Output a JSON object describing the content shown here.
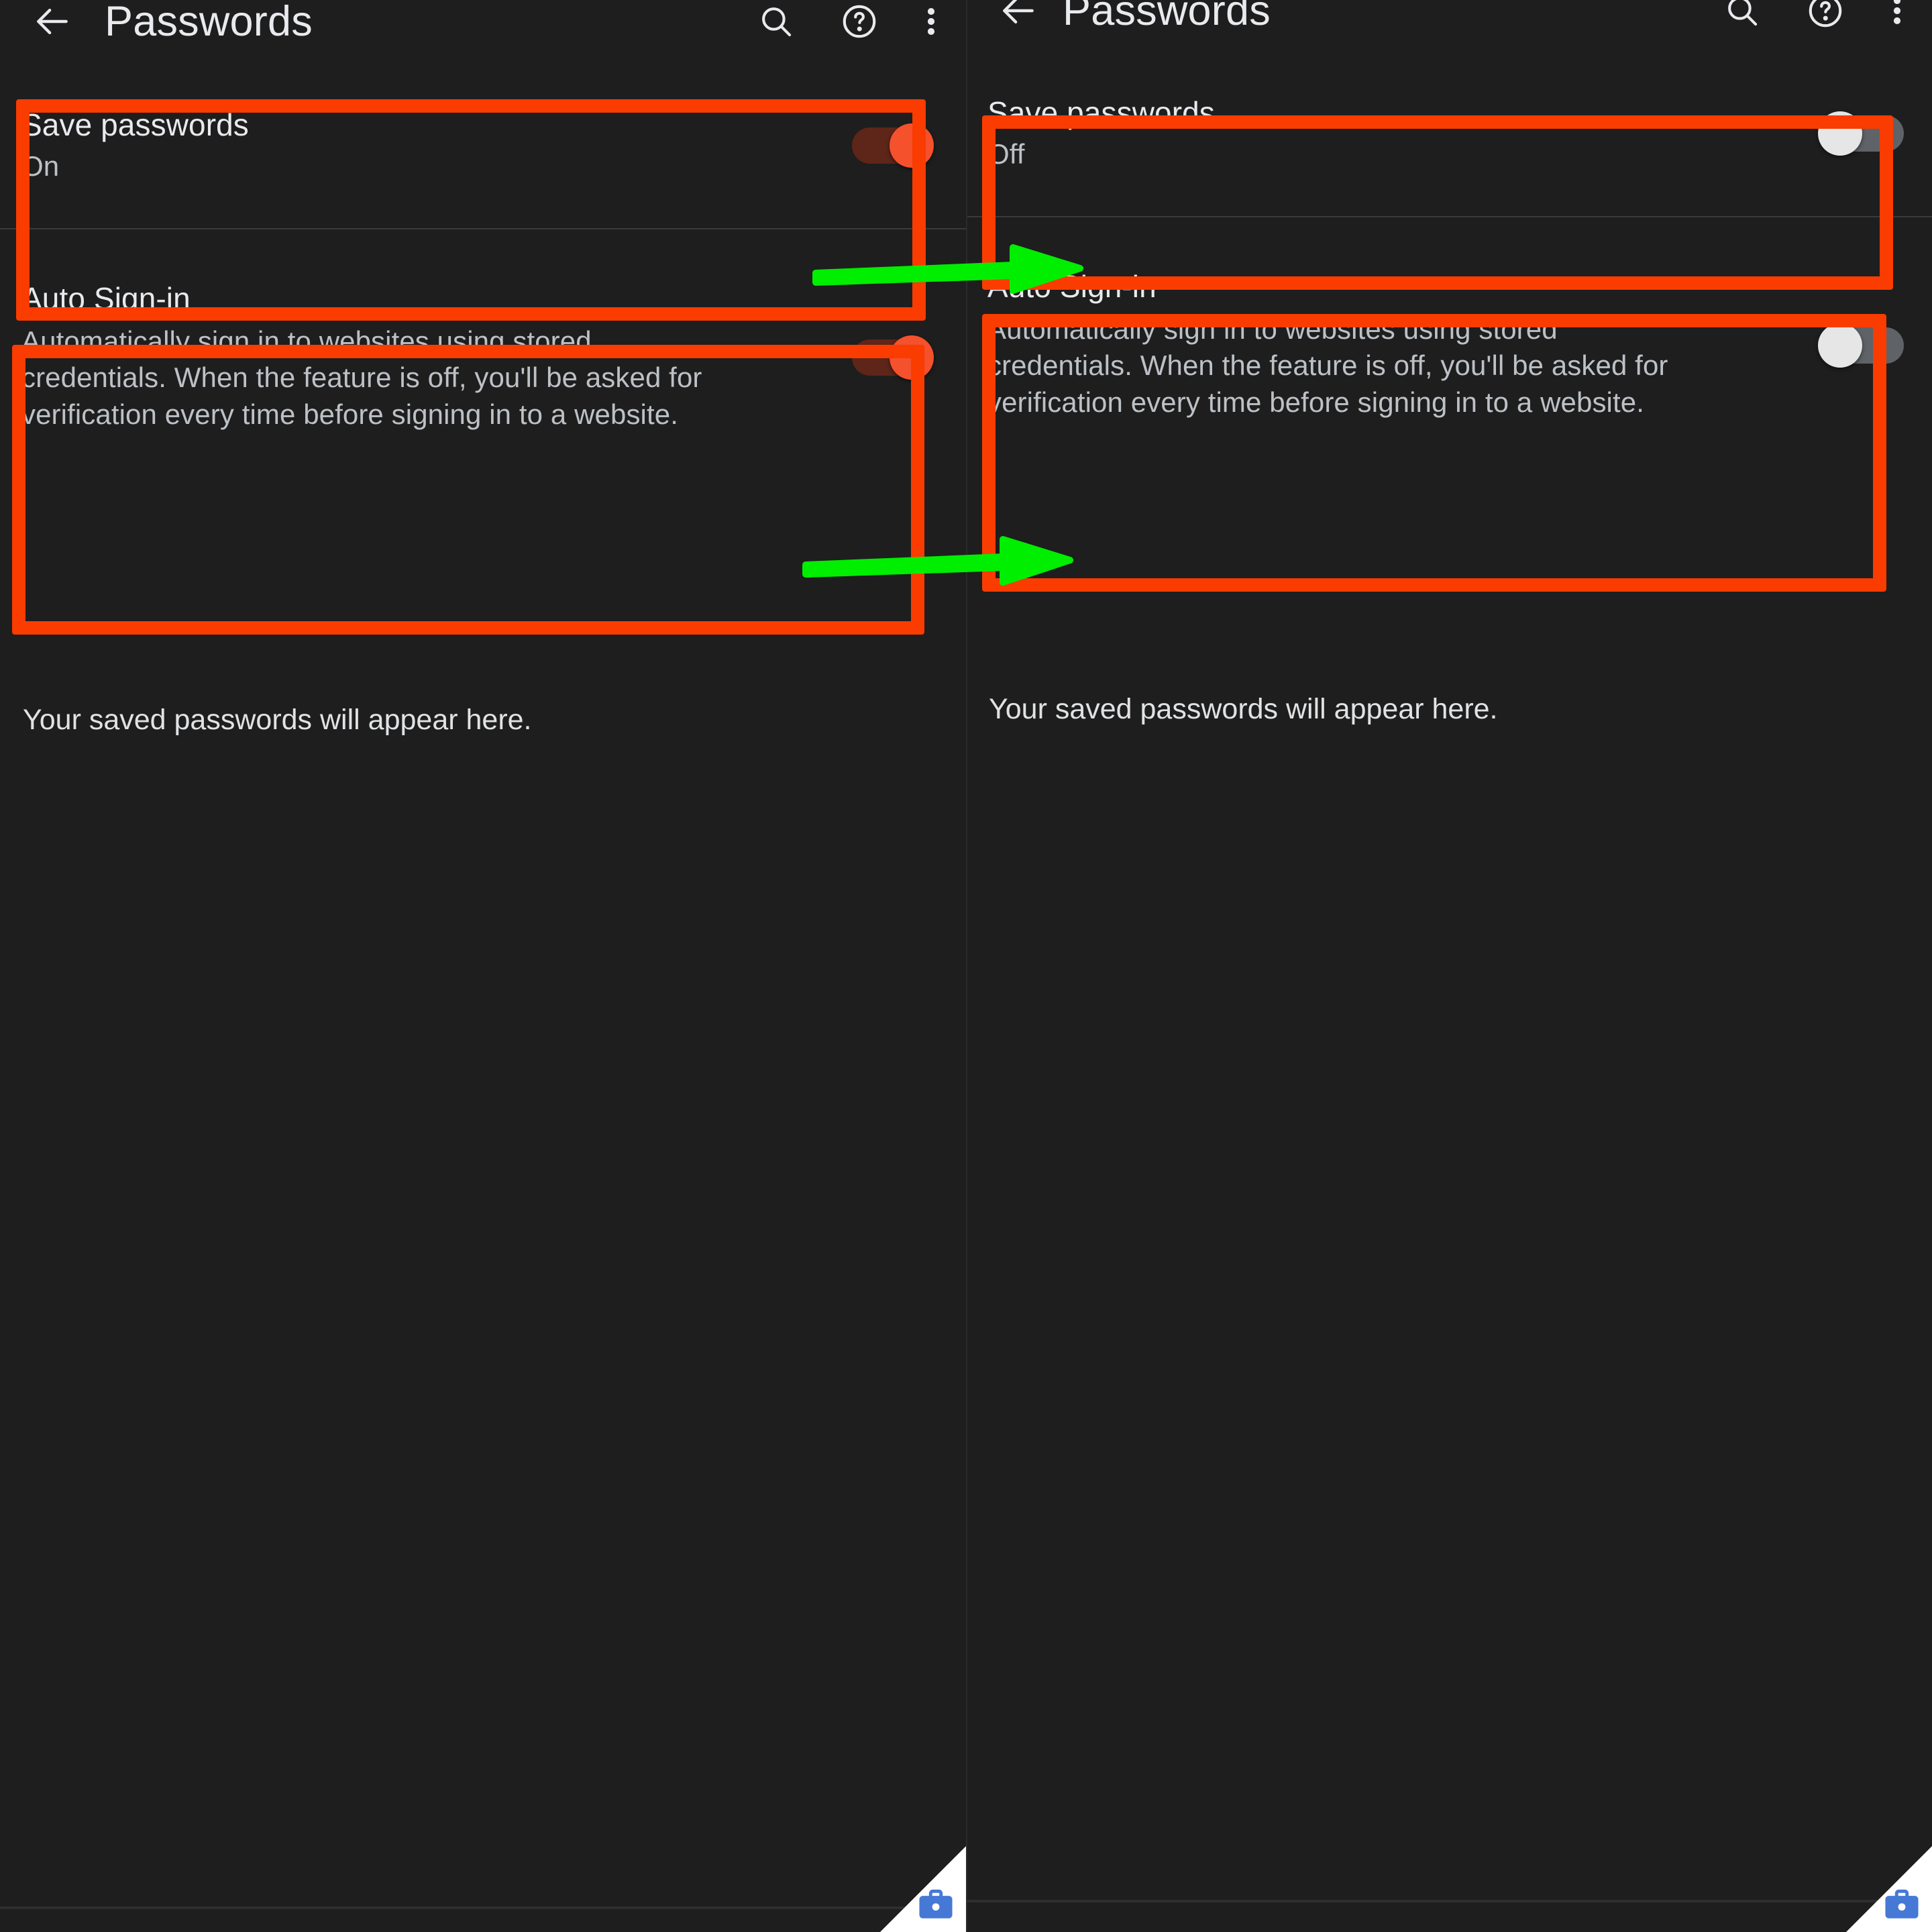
{
  "meta": {
    "layout": "side-by-side before/after mobile screenshot comparison",
    "background_color": "#1e1e1e",
    "annotation_box_color": "#fa3c00",
    "annotation_arrow_color": "#00ee00",
    "accent_on_color": "#f4512c",
    "track_off_color": "#5f6368"
  },
  "panels": [
    {
      "id": "before",
      "appbar": {
        "back_label": "Navigate up",
        "title": "Passwords",
        "actions": [
          {
            "name": "search",
            "label": "Search passwords"
          },
          {
            "name": "help",
            "label": "Help & feedback"
          },
          {
            "name": "overflow",
            "label": "More options"
          }
        ]
      },
      "settings": [
        {
          "name": "save-passwords",
          "title": "Save passwords",
          "summary": "On",
          "toggle_state": "on",
          "toggle_label": "On"
        },
        {
          "name": "auto-sign-in",
          "title": "Auto Sign-in",
          "summary": "Automatically sign in to websites using stored credentials. When the feature is off, you'll be asked for verification every time before signing in to a website.",
          "toggle_state": "on",
          "toggle_label": "On"
        }
      ],
      "empty_state": "Your saved passwords will appear here.",
      "corner_badge": "work-profile-briefcase"
    },
    {
      "id": "after",
      "appbar": {
        "back_label": "Navigate up",
        "title": "Passwords",
        "actions": [
          {
            "name": "search",
            "label": "Search passwords"
          },
          {
            "name": "help",
            "label": "Help & feedback"
          },
          {
            "name": "overflow",
            "label": "More options"
          }
        ]
      },
      "settings": [
        {
          "name": "save-passwords",
          "title": "Save passwords",
          "summary": "Off",
          "toggle_state": "off",
          "toggle_label": "Off"
        },
        {
          "name": "auto-sign-in",
          "title": "Auto Sign-in",
          "summary": "Automatically sign in to websites using stored credentials. When the feature is off, you'll be asked for verification every time before signing in to a website.",
          "toggle_state": "off",
          "toggle_label": "Off"
        }
      ],
      "empty_state": "Your saved passwords will appear here.",
      "corner_badge": "work-profile-briefcase"
    }
  ],
  "annotations": {
    "highlight_boxes": [
      {
        "name": "highlight-save-passwords-before",
        "panel": "before"
      },
      {
        "name": "highlight-auto-sign-in-before",
        "panel": "before"
      },
      {
        "name": "highlight-save-passwords-after",
        "panel": "after"
      },
      {
        "name": "highlight-auto-sign-in-after",
        "panel": "after"
      }
    ],
    "arrows": [
      {
        "name": "arrow-save-passwords",
        "direction": "right"
      },
      {
        "name": "arrow-auto-sign-in",
        "direction": "right"
      }
    ]
  }
}
